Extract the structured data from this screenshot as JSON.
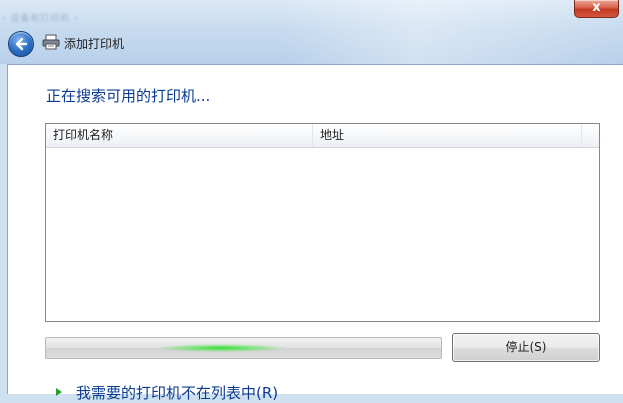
{
  "window": {
    "close_label": "x",
    "background_title_blurred": "‹ 设备和打印机 ›"
  },
  "navbar": {
    "title": "添加打印机",
    "back_icon": "back-arrow-icon",
    "printer_icon": "printer-icon"
  },
  "main": {
    "heading": "正在搜索可用的打印机...",
    "list": {
      "columns": [
        "打印机名称",
        "地址",
        ""
      ],
      "rows": []
    },
    "progress": {
      "state": "indeterminate"
    },
    "stop_button_label": "停止(S)",
    "missing_printer_link": "我需要的打印机不在列表中(R)"
  },
  "colors": {
    "heading_blue": "#0a3b91",
    "progress_green": "#34dc34",
    "close_red": "#c0391f"
  }
}
